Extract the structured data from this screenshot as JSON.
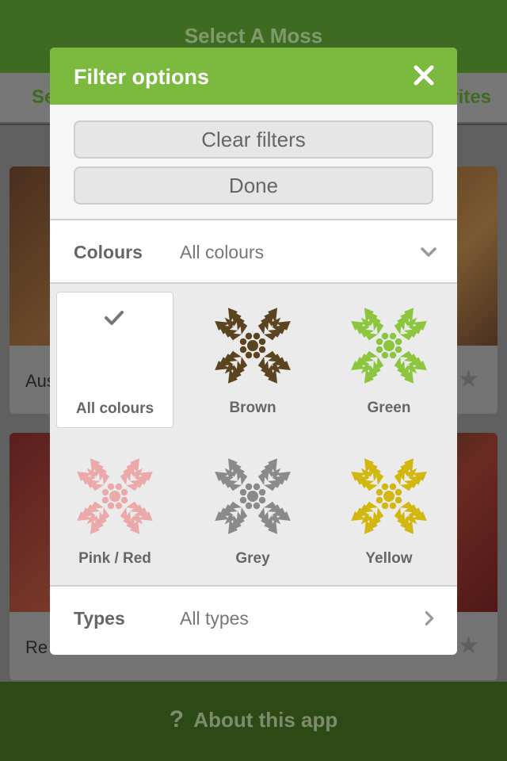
{
  "app": {
    "title": "Select A Moss",
    "tab_left_partial": "Se",
    "tab_right_partial": "rites",
    "cards": [
      {
        "name_partial": "Aus"
      },
      {
        "name_partial": "Re"
      }
    ],
    "bottom_question": "?",
    "bottom_label": "About this app"
  },
  "modal": {
    "title": "Filter options",
    "clear_label": "Clear filters",
    "done_label": "Done",
    "colours_label": "Colours",
    "colours_value": "All colours",
    "types_label": "Types",
    "types_value": "All types",
    "options": [
      {
        "label": "All colours",
        "selected": true
      },
      {
        "label": "Brown",
        "color": "#5b4420"
      },
      {
        "label": "Green",
        "color": "#8cc63f"
      },
      {
        "label": "Pink / Red",
        "color": "#eca9a9"
      },
      {
        "label": "Grey",
        "color": "#8a8a8a"
      },
      {
        "label": "Yellow",
        "color": "#d2b70f"
      }
    ]
  },
  "colors": {
    "header_green": "#7bba3e",
    "topbar_dim": "#3f6a22",
    "bottombar_dim": "#2d4a16"
  }
}
